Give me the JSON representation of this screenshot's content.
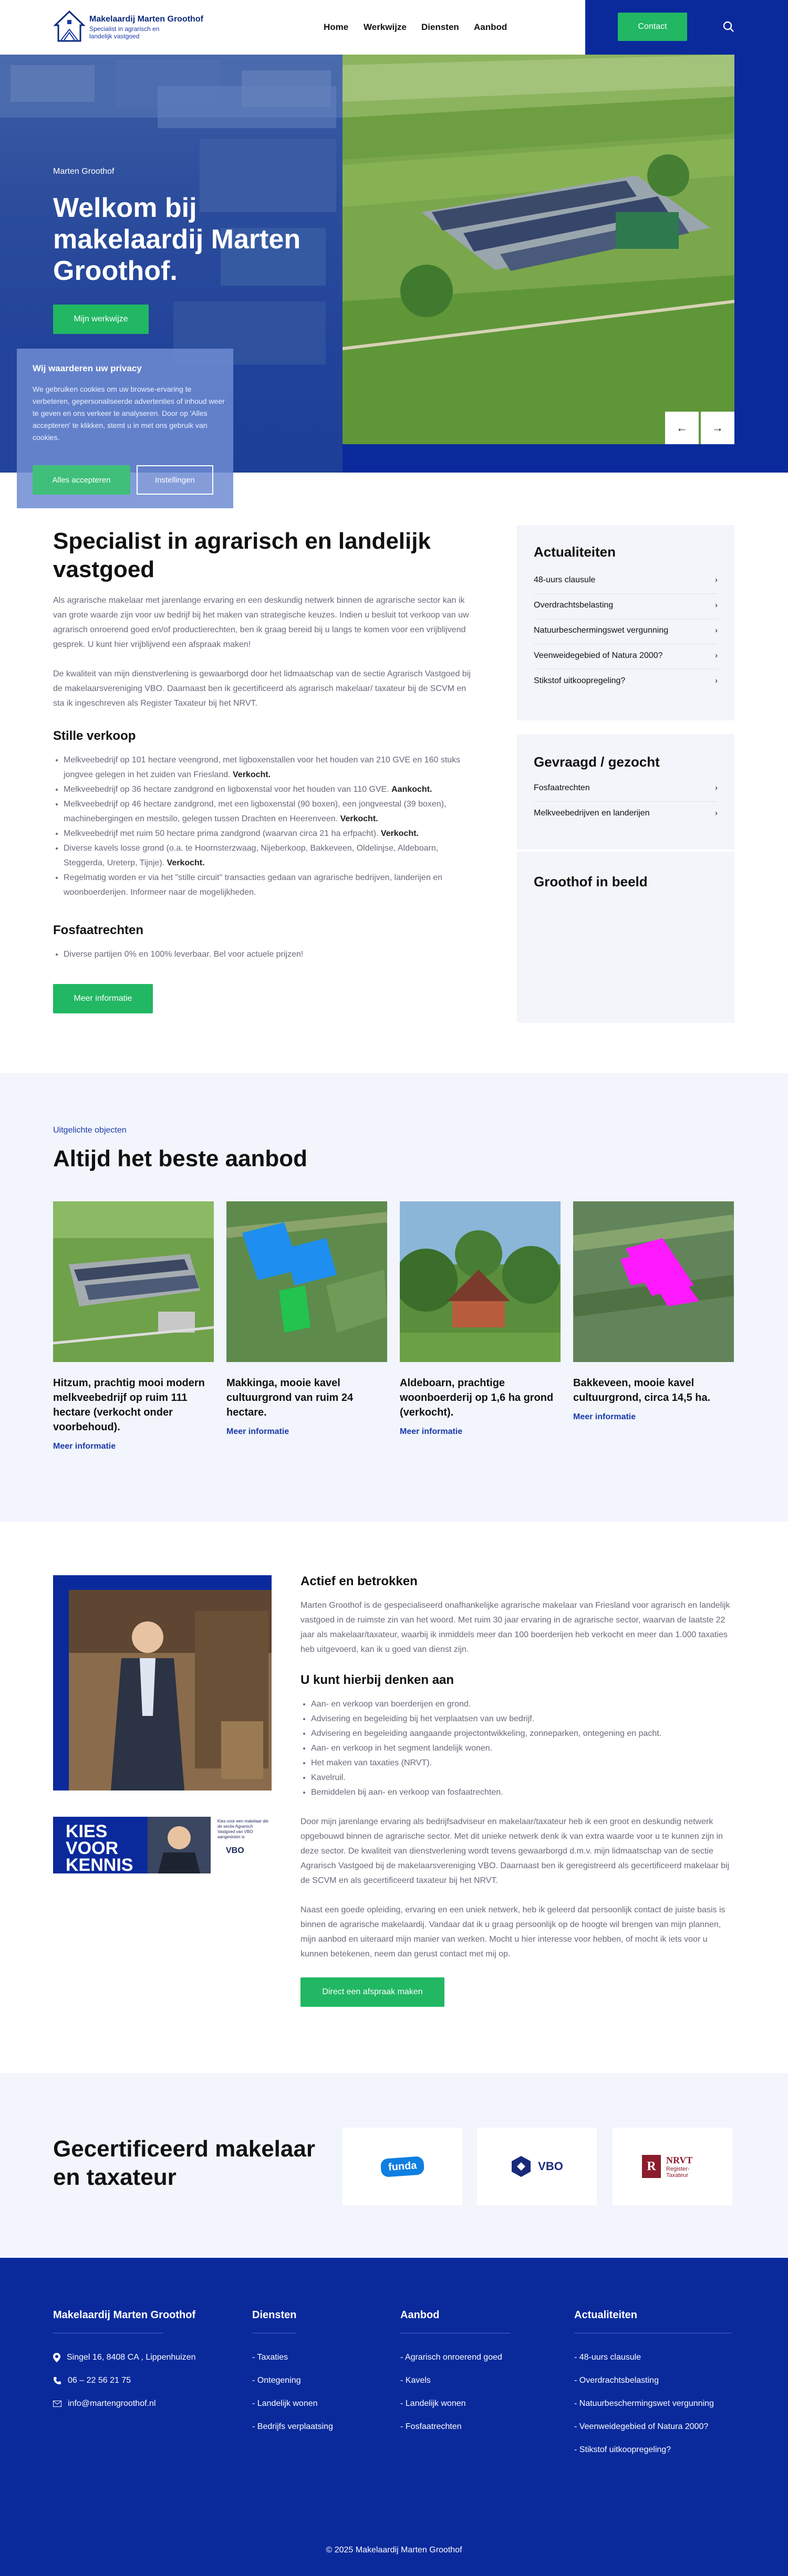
{
  "header": {
    "logo_title": "Makelaardij Marten Groothof",
    "logo_sub": "Specialist in agrarisch en landelijk vastgoed",
    "nav": [
      "Home",
      "Werkwijze",
      "Diensten",
      "Aanbod"
    ],
    "contact": "Contact"
  },
  "hero": {
    "kicker": "Marten Groothof",
    "title": "Welkom bij makelaardij Marten Groothof.",
    "button": "Mijn werkwijze",
    "prev": "←",
    "next": "→"
  },
  "privacy": {
    "title": "Wij waarderen uw privacy",
    "text": "We gebruiken cookies om uw browse-ervaring te verbeteren, gepersonaliseerde advertenties of inhoud weer te geven en ons verkeer te analyseren. Door op 'Alles accepteren' te klikken, stemt u in met ons gebruik van cookies.",
    "accept": "Alles accepteren",
    "settings": "Instellingen"
  },
  "specialist": {
    "title": "Specialist in agrarisch en landelijk vastgoed",
    "p1": "Als agrarische makelaar met jarenlange ervaring en een deskundig netwerk binnen de agrarische sector kan ik van grote waarde zijn voor uw bedrijf bij het maken van strategische keuzes. Indien u besluit tot verkoop van uw agrarisch onroerend goed en/of productierechten, ben ik graag bereid bij u langs te komen voor een vrijblijvend gesprek. U kunt hier vrijblijvend een afspraak maken!",
    "p2": "De kwaliteit van mijn dienstverlening is gewaarborgd door het lidmaatschap van de sectie Agrarisch Vastgoed bij de makelaarsvereniging VBO. Daarnaast ben ik gecertificeerd als agrarisch makelaar/ taxateur bij de SCVM en sta ik ingeschreven als Register Taxateur bij het NRVT.",
    "stille_title": "Stille verkoop",
    "stille": [
      {
        "t": "Melkveebedrijf op 101 hectare veengrond, met ligboxenstallen voor het houden van 210 GVE en 160 stuks jongvee gelegen in het zuiden van Friesland. ",
        "b": "Verkocht."
      },
      {
        "t": "Melkveebedrijf op 36 hectare zandgrond en ligboxenstal voor het houden van 110 GVE. ",
        "b": "Aankocht."
      },
      {
        "t": "Melkveebedrijf op 46 hectare zandgrond, met een ligboxenstal (90 boxen), een jongveestal (39 boxen), machinebergingen en mestsilo, gelegen tussen Drachten en Heerenveen. ",
        "b": "Verkocht."
      },
      {
        "t": "Melkveebedrijf met ruim 50 hectare prima zandgrond (waarvan circa 21 ha erfpacht). ",
        "b": "Verkocht."
      },
      {
        "t": "Diverse kavels losse grond (o.a. te Hoornsterzwaag, Nijeberkoop, Bakkeveen, Oldelinjse, Aldeboarn, Steggerda, Ureterp, Tijnje). ",
        "b": "Verkocht."
      },
      {
        "t": "Regelmatig worden er via het \"stille circuit\" transacties gedaan van agrarische bedrijven, landerijen en woonboerderijen. Informeer naar de mogelijkheden.",
        "b": ""
      }
    ],
    "fosfaat_title": "Fosfaatrechten",
    "fosfaat": [
      "Diverse partijen 0% en 100% leverbaar. Bel voor actuele prijzen!"
    ],
    "button": "Meer informatie"
  },
  "sidebar": {
    "actualiteiten_title": "Actualiteiten",
    "actualiteiten": [
      "48-uurs clausule",
      "Overdrachtsbelasting",
      "Natuurbeschermingswet vergunning",
      "Veenweidegebied of Natura 2000?",
      "Stikstof uitkoopregeling?"
    ],
    "gevraagd_title": "Gevraagd / gezocht",
    "gevraagd": [
      "Fosfaatrechten",
      "Melkveebedrijven en landerijen"
    ],
    "beeld_title": "Groothof in beeld",
    "chevron": "›"
  },
  "objects": {
    "kicker": "Uitgelichte objecten",
    "title": "Altijd het beste aanbod",
    "items": [
      {
        "title": "Hitzum, prachtig mooi modern melkveebedrijf op ruim 111 hectare (verkocht onder voorbehoud).",
        "more": "Meer informatie"
      },
      {
        "title": "Makkinga, mooie kavel cultuurgrond van ruim 24 hectare.",
        "more": "Meer informatie"
      },
      {
        "title": "Aldeboarn, prachtige woonboerderij op 1,6 ha grond (verkocht).",
        "more": "Meer informatie"
      },
      {
        "title": "Bakkeveen, mooie kavel cultuurgrond, circa 14,5 ha.",
        "more": "Meer informatie"
      }
    ]
  },
  "about": {
    "title1": "Actief en betrokken",
    "p1": "Marten Groothof is de gespecialiseerd onafhankelijke agrarische makelaar van Friesland voor agrarisch en landelijk vastgoed in de ruimste zin van het woord. Met ruim 30 jaar ervaring in de agrarische sector, waarvan de laatste 22 jaar als makelaar/taxateur, waarbij ik inmiddels meer dan 100 boerderijen heb verkocht en meer dan 1.000 taxaties heb uitgevoerd, kan ik u goed van dienst zijn.",
    "title2": "U kunt hierbij denken aan",
    "list": [
      "Aan- en verkoop van boerderijen en grond.",
      "Advisering en begeleiding bij het verplaatsen van uw bedrijf.",
      "Advisering en begeleiding aangaande projectontwikkeling, zonneparken, ontegening en pacht.",
      "Aan- en verkoop in het segment landelijk wonen.",
      "Het maken van taxaties (NRVT).",
      "Kavelruil.",
      "Bemiddelen bij aan- en verkoop van fosfaatrechten."
    ],
    "p2": "Door mijn jarenlange ervaring als bedrijfsadviseur en makelaar/taxateur heb ik een groot en deskundig netwerk opgebouwd binnen de agrarische sector. Met dit unieke netwerk denk ik van extra waarde voor u te kunnen zijn in deze sector. De kwaliteit van dienstverlening wordt tevens gewaarborgd d.m.v. mijn lidmaatschap van de sectie Agrarisch Vastgoed bij de makelaarsvereniging VBO. Daarnaast ben ik geregistreerd als gecertificeerd makelaar bij de SCVM en als gecertificeerd taxateur bij het NRVT.",
    "p3": "Naast een goede opleiding, ervaring en een uniek netwerk, heb ik geleerd dat persoonlijk contact de juiste basis is binnen de agrarische makelaardij. Vandaar dat ik u graag persoonlijk op de hoogte wil brengen van mijn plannen, mijn aanbod en uiteraard mijn manier van werken. Mocht u hier interesse voor hebben, of mocht ik iets voor u kunnen betekenen, neem dan gerust contact met mij op.",
    "button": "Direct een afspraak maken",
    "banner_text": "KIES VOOR KENNIS",
    "banner_small": "Kies voor een makelaar die de sectie Agrarisch Vastgoed van VBO aangesloten is",
    "banner_logo": "VBO"
  },
  "cert": {
    "title": "Gecertificeerd makelaar en taxateur",
    "logos": [
      "funda",
      "VBO",
      "NRVT"
    ],
    "nrvt_small": "Register-Taxateur"
  },
  "footer": {
    "col1_title": "Makelaardij Marten Groothof",
    "address": "Singel 16, 8408 CA , Lippenhuizen",
    "phone": "06 – 22 56 21 75",
    "email": "info@martengroothof.nl",
    "col2_title": "Diensten",
    "col2": [
      "- Taxaties",
      "- Ontegening",
      "- Landelijk wonen",
      "- Bedrijfs verplaatsing"
    ],
    "col3_title": "Aanbod",
    "col3": [
      "- Agrarisch onroerend goed",
      "- Kavels",
      "- Landelijk wonen",
      "- Fosfaatrechten"
    ],
    "col4_title": "Actualiteiten",
    "col4": [
      "- 48-uurs clausule",
      "- Overdrachtsbelasting",
      "- Natuurbeschermingswet vergunning",
      "- Veenweidegebied of Natura 2000?",
      "- Stikstof uitkoopregeling?"
    ],
    "copyright": "© 2025 Makelaardij Marten Groothof"
  },
  "colors": {
    "brand_blue": "#0a2a9c",
    "accent_green": "#21b763",
    "bg_light": "#f2f5fc"
  }
}
